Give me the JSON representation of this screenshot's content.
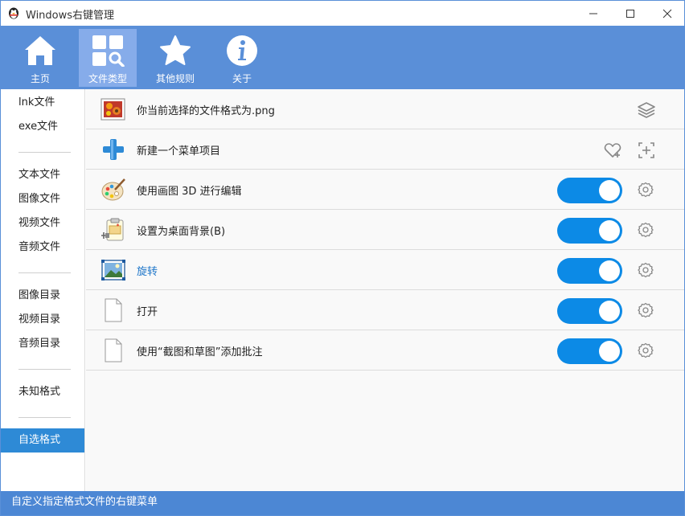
{
  "window": {
    "title": "Windows右键管理",
    "icon": "penguin-icon"
  },
  "toolbar": {
    "items": [
      {
        "label": "主页",
        "icon": "home-icon",
        "active": false
      },
      {
        "label": "文件类型",
        "icon": "file-types-icon",
        "active": true
      },
      {
        "label": "其他规则",
        "icon": "star-icon",
        "active": false
      },
      {
        "label": "关于",
        "icon": "info-icon",
        "active": false
      }
    ]
  },
  "sidebar": {
    "items": [
      {
        "label": "lnk文件"
      },
      {
        "label": "exe文件"
      },
      {
        "label": "文本文件"
      },
      {
        "label": "图像文件"
      },
      {
        "label": "视频文件"
      },
      {
        "label": "音频文件"
      },
      {
        "label": "图像目录"
      },
      {
        "label": "视频目录"
      },
      {
        "label": "音频目录"
      },
      {
        "label": "未知格式"
      },
      {
        "label": "自选格式",
        "selected": true
      }
    ]
  },
  "main": {
    "rows": [
      {
        "label": "你当前选择的文件格式为.png",
        "icon": "picture-file-icon",
        "right_icon": "layers-icon"
      },
      {
        "label": "新建一个菜单项目",
        "icon": "add-plus-icon",
        "right_icons": [
          "favorite-heart-icon",
          "add-item-icon"
        ]
      },
      {
        "label": "使用画图 3D 进行编辑",
        "icon": "paint-palette-icon",
        "enabled": true
      },
      {
        "label": "设置为桌面背景(B)",
        "icon": "clipboard-plug-icon",
        "enabled": true
      },
      {
        "label": "旋转",
        "icon": "rotate-image-icon",
        "enabled": true,
        "link": true
      },
      {
        "label": "打开",
        "icon": "blank-file-icon",
        "enabled": true
      },
      {
        "label": "使用“截图和草图”添加批注",
        "icon": "blank-file-icon",
        "enabled": true
      }
    ]
  },
  "statusbar": {
    "text": "自定义指定格式文件的右键菜单"
  },
  "colors": {
    "accent": "#5a8fd8",
    "toggle_on": "#0c8ae6",
    "selected": "#2e8ad6",
    "status": "#4c87d4"
  }
}
